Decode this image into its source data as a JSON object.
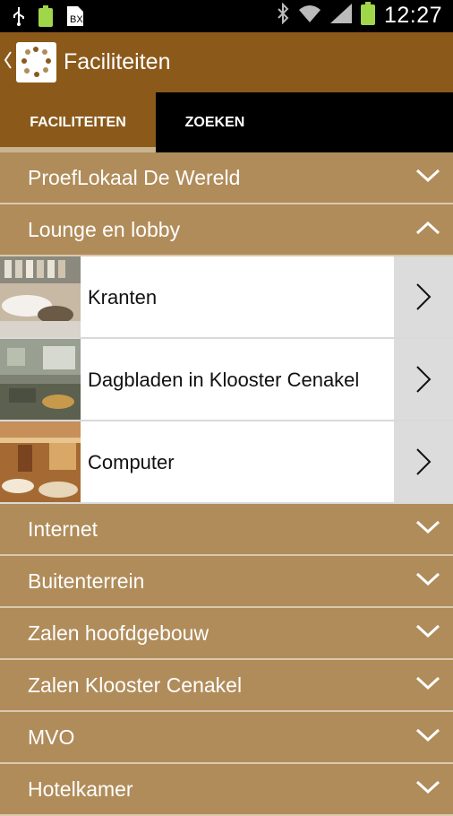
{
  "statusbar": {
    "time": "12:27",
    "icons_left": [
      "usb-icon",
      "battery-full-icon",
      "document-x-icon"
    ],
    "icons_right": [
      "bluetooth-icon",
      "wifi-icon",
      "signal-icon",
      "battery-icon"
    ]
  },
  "header": {
    "title": "Faciliteiten",
    "colors": {
      "bar": "#8b5a1b",
      "section": "#b08c5a"
    }
  },
  "tabs": [
    {
      "label": "FACILITEITEN",
      "selected": true
    },
    {
      "label": "ZOEKEN",
      "selected": false
    }
  ],
  "sections": [
    {
      "label": "ProefLokaal De Wereld",
      "expanded": false
    },
    {
      "label": "Lounge en lobby",
      "expanded": true,
      "items": [
        {
          "label": "Kranten"
        },
        {
          "label": "Dagbladen in Klooster Cenakel"
        },
        {
          "label": "Computer"
        }
      ]
    },
    {
      "label": "Internet",
      "expanded": false
    },
    {
      "label": "Buitenterrein",
      "expanded": false
    },
    {
      "label": "Zalen hoofdgebouw",
      "expanded": false
    },
    {
      "label": "Zalen Klooster Cenakel",
      "expanded": false
    },
    {
      "label": "MVO",
      "expanded": false
    },
    {
      "label": "Hotelkamer",
      "expanded": false
    }
  ]
}
